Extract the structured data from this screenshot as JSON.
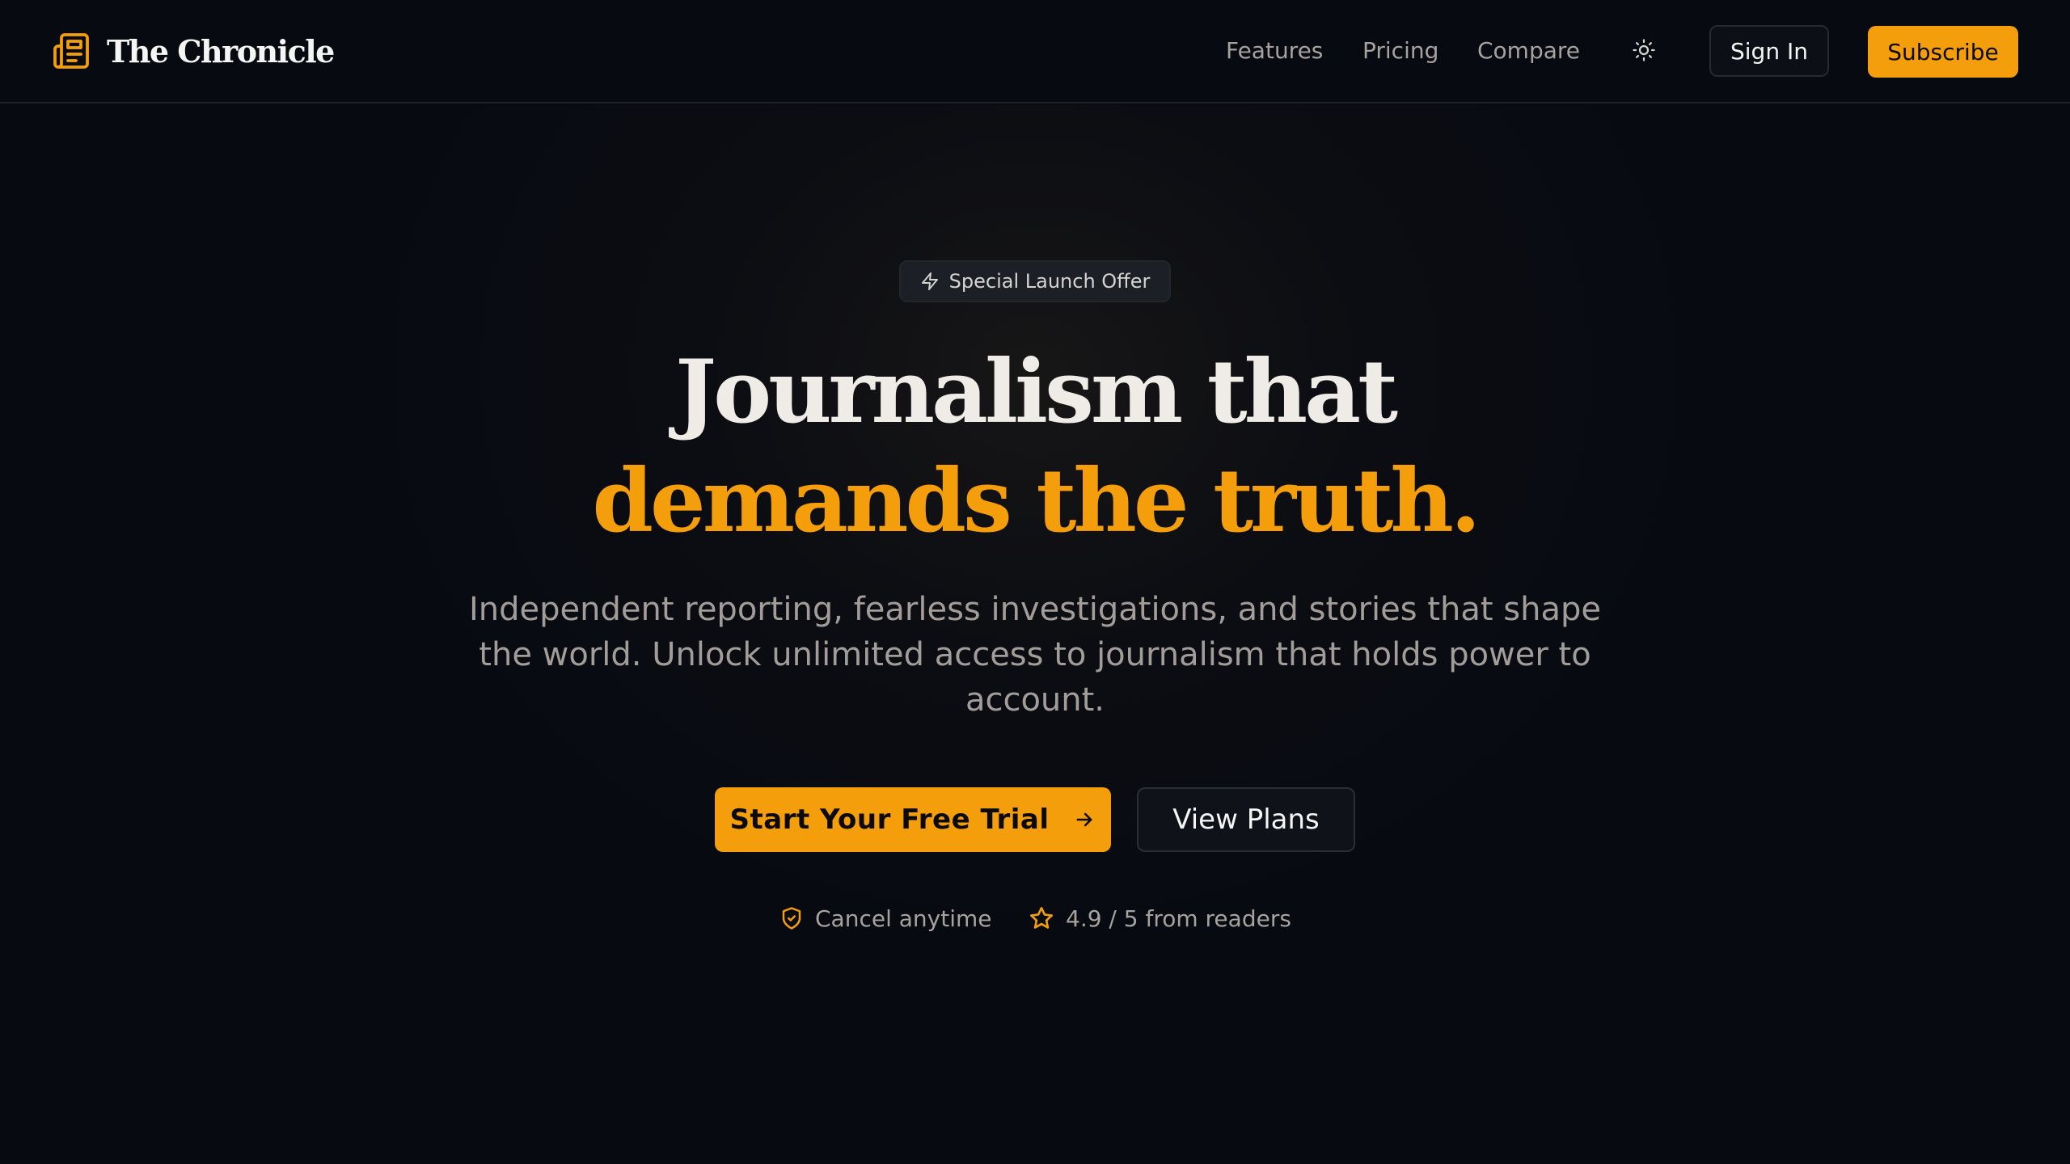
{
  "brand": {
    "name": "The Chronicle",
    "icon": "newspaper-icon",
    "accent_color": "#f59e0b"
  },
  "nav": {
    "links": [
      {
        "label": "Features"
      },
      {
        "label": "Pricing"
      },
      {
        "label": "Compare"
      }
    ],
    "theme_toggle_icon": "sun-icon",
    "sign_in_label": "Sign In",
    "subscribe_label": "Subscribe"
  },
  "hero": {
    "badge": {
      "icon": "lightning-icon",
      "label": "Special Launch Offer"
    },
    "headline_line1": "Journalism that",
    "headline_line2": "demands the truth.",
    "subtext": "Independent reporting, fearless investigations, and stories that shape the world. Unlock unlimited access to journalism that holds power to account.",
    "primary_cta": {
      "label": "Start Your Free Trial",
      "icon": "arrow-right-icon"
    },
    "secondary_cta": {
      "label": "View Plans"
    },
    "trust": [
      {
        "icon": "shield-check-icon",
        "label": "Cancel anytime"
      },
      {
        "icon": "star-icon",
        "label": "4.9 / 5 from readers"
      }
    ]
  },
  "colors": {
    "background": "#070a11",
    "accent": "#f59e0b",
    "muted_text": "#a8a29e"
  }
}
